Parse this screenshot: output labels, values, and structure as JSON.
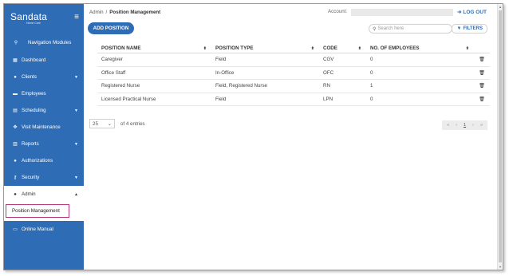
{
  "brand": {
    "name": "Sandata",
    "tagline": "Home Care"
  },
  "sidebar": {
    "items": [
      {
        "label": "Navigation Modules",
        "icon": "search-icon"
      },
      {
        "label": "Dashboard",
        "icon": "grid-icon"
      },
      {
        "label": "Clients",
        "icon": "users-icon",
        "expandable": true
      },
      {
        "label": "Employees",
        "icon": "id-card-icon"
      },
      {
        "label": "Scheduling",
        "icon": "calendar-icon",
        "expandable": true
      },
      {
        "label": "Visit Maintenance",
        "icon": "tools-icon"
      },
      {
        "label": "Reports",
        "icon": "bar-chart-icon",
        "expandable": true
      },
      {
        "label": "Authorizations",
        "icon": "users-icon"
      },
      {
        "label": "Security",
        "icon": "key-icon",
        "expandable": true
      },
      {
        "label": "Admin",
        "icon": "users-icon",
        "expanded": true
      },
      {
        "label": "Online Manual",
        "icon": "book-icon"
      }
    ],
    "admin_subitem": "Position Management"
  },
  "header": {
    "breadcrumb_root": "Admin",
    "breadcrumb_sep": "/",
    "breadcrumb_current": "Position Management",
    "account_label": "Account:",
    "logout_label": "LOG OUT"
  },
  "toolbar": {
    "add_label": "ADD POSITION",
    "search_placeholder": "Search here",
    "filters_label": "FILTERS"
  },
  "table": {
    "columns": [
      "POSITION NAME",
      "POSITION TYPE",
      "CODE",
      "NO. OF EMPLOYEES"
    ],
    "rows": [
      [
        "Caregiver",
        "Field",
        "CGV",
        "0"
      ],
      [
        "Office Staff",
        "In-Office",
        "OFC",
        "0"
      ],
      [
        "Registered Nurse",
        "Field, Registered Nurse",
        "RN",
        "1"
      ],
      [
        "Licensed Practical Nurse",
        "Field",
        "LPN",
        "0"
      ]
    ]
  },
  "pagination": {
    "page_size": "25",
    "entries_text": "of 4 entries",
    "current_page": "1",
    "first": "«",
    "prev": "‹",
    "next": "›",
    "last": "»"
  },
  "colors": {
    "accent": "#2e6db5",
    "highlight": "#b33a7a"
  }
}
